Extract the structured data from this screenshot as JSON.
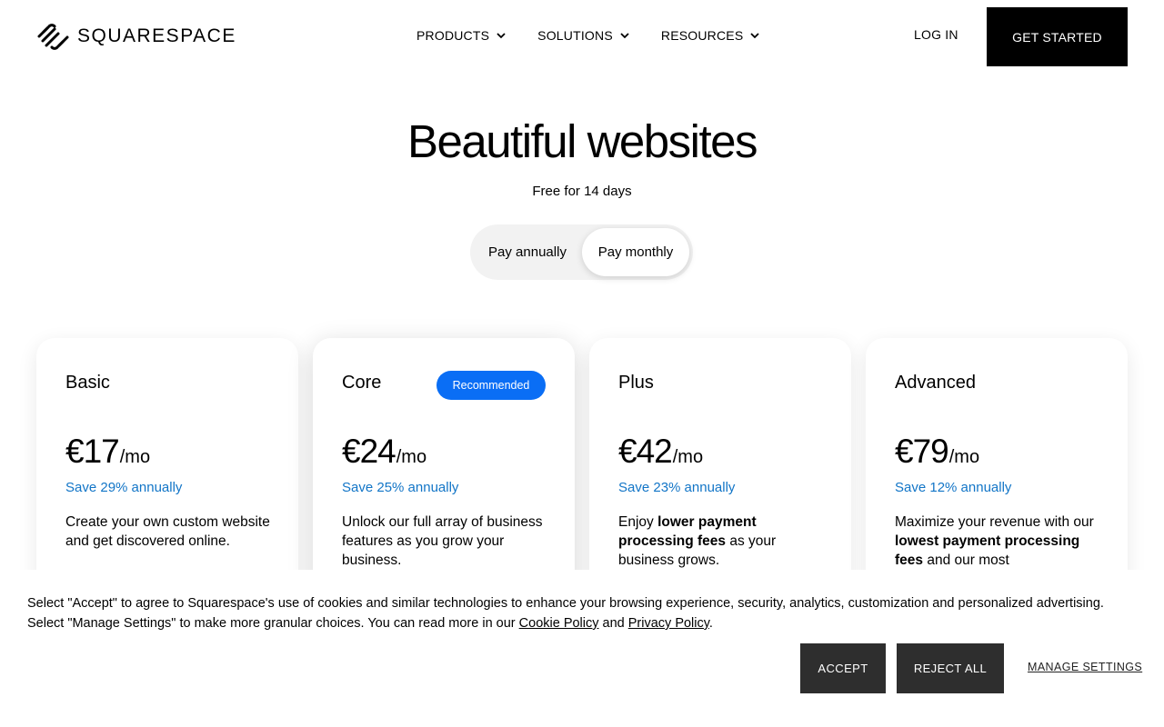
{
  "header": {
    "brand": "SQUARESPACE",
    "nav": [
      {
        "label": "PRODUCTS"
      },
      {
        "label": "SOLUTIONS"
      },
      {
        "label": "RESOURCES"
      }
    ],
    "login": "LOG IN",
    "cta": "GET STARTED"
  },
  "hero": {
    "title": "Beautiful websites",
    "subtitle": "Free for 14 days"
  },
  "billing_toggle": {
    "options": [
      "Pay annually",
      "Pay monthly"
    ],
    "selected": "Pay monthly"
  },
  "plans": [
    {
      "name": "Basic",
      "badge": "",
      "price": "€17",
      "per": "/mo",
      "save": "Save 29% annually",
      "desc": [
        {
          "t": "Create your own custom website and get discovered online.",
          "b": false
        }
      ]
    },
    {
      "name": "Core",
      "badge": "Recommended",
      "price": "€24",
      "per": "/mo",
      "save": "Save 25% annually",
      "desc": [
        {
          "t": "Unlock our full array of business features as you grow your business.",
          "b": false
        }
      ]
    },
    {
      "name": "Plus",
      "badge": "",
      "price": "€42",
      "per": "/mo",
      "save": "Save 23% annually",
      "desc": [
        {
          "t": "Enjoy ",
          "b": false
        },
        {
          "t": "lower payment processing fees",
          "b": true
        },
        {
          "t": " as your business grows.",
          "b": false
        }
      ]
    },
    {
      "name": "Advanced",
      "badge": "",
      "price": "€79",
      "per": "/mo",
      "save": "Save 12% annually",
      "desc": [
        {
          "t": "Maximize your revenue with our ",
          "b": false
        },
        {
          "t": "lowest payment processing fees",
          "b": true
        },
        {
          "t": " and our most",
          "b": false
        }
      ]
    }
  ],
  "cookie": {
    "text_1": "Select \"Accept\" to agree to Squarespace's use of cookies and similar technologies to enhance your browsing experience, security, analytics, customization and personalized advertising. Select \"Manage Settings\" to make more granular choices. You can read more in our ",
    "cookie_policy": "Cookie Policy",
    "and": " and ",
    "privacy_policy": "Privacy Policy",
    "end": ".",
    "accept": "ACCEPT",
    "reject": "REJECT ALL",
    "manage": "MANAGE SETTINGS"
  },
  "colors": {
    "badge": "#0a6ef5",
    "save_text": "#1275c7",
    "cta_bg": "#000000",
    "cookie_btn": "#2e2e2e"
  },
  "icons": [
    "squarespace-logo-icon",
    "chevron-down-icon"
  ]
}
